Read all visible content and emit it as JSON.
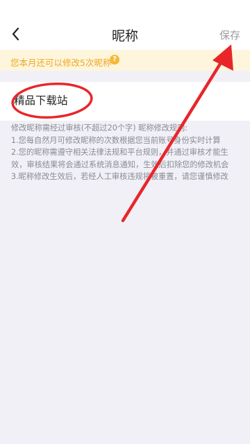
{
  "header": {
    "title": "昵称",
    "save_label": "保存",
    "back_icon": "chevron-left-icon"
  },
  "notice": {
    "text": "您本月还可以修改5次昵称",
    "help_icon": "question-icon",
    "help_glyph": "?"
  },
  "nickname": {
    "value": "精品下载站"
  },
  "rules": {
    "lines": [
      "修改昵称需经过审核(不超过20个字) 昵称修改规则:",
      "1.您每自然月可修改昵称的次数根据您当前账号身份实时计算",
      "2.您的昵称需遵守相关法律法规和平台规则，并通过审核才能生",
      "效，审核结果将会通过系统消息通知，生效后扣除您的修改机会",
      "3.昵称修改生效后，若经人工审核违规将被重置，请您谨慎修改"
    ]
  },
  "annotation": {
    "color": "#e8262a"
  }
}
